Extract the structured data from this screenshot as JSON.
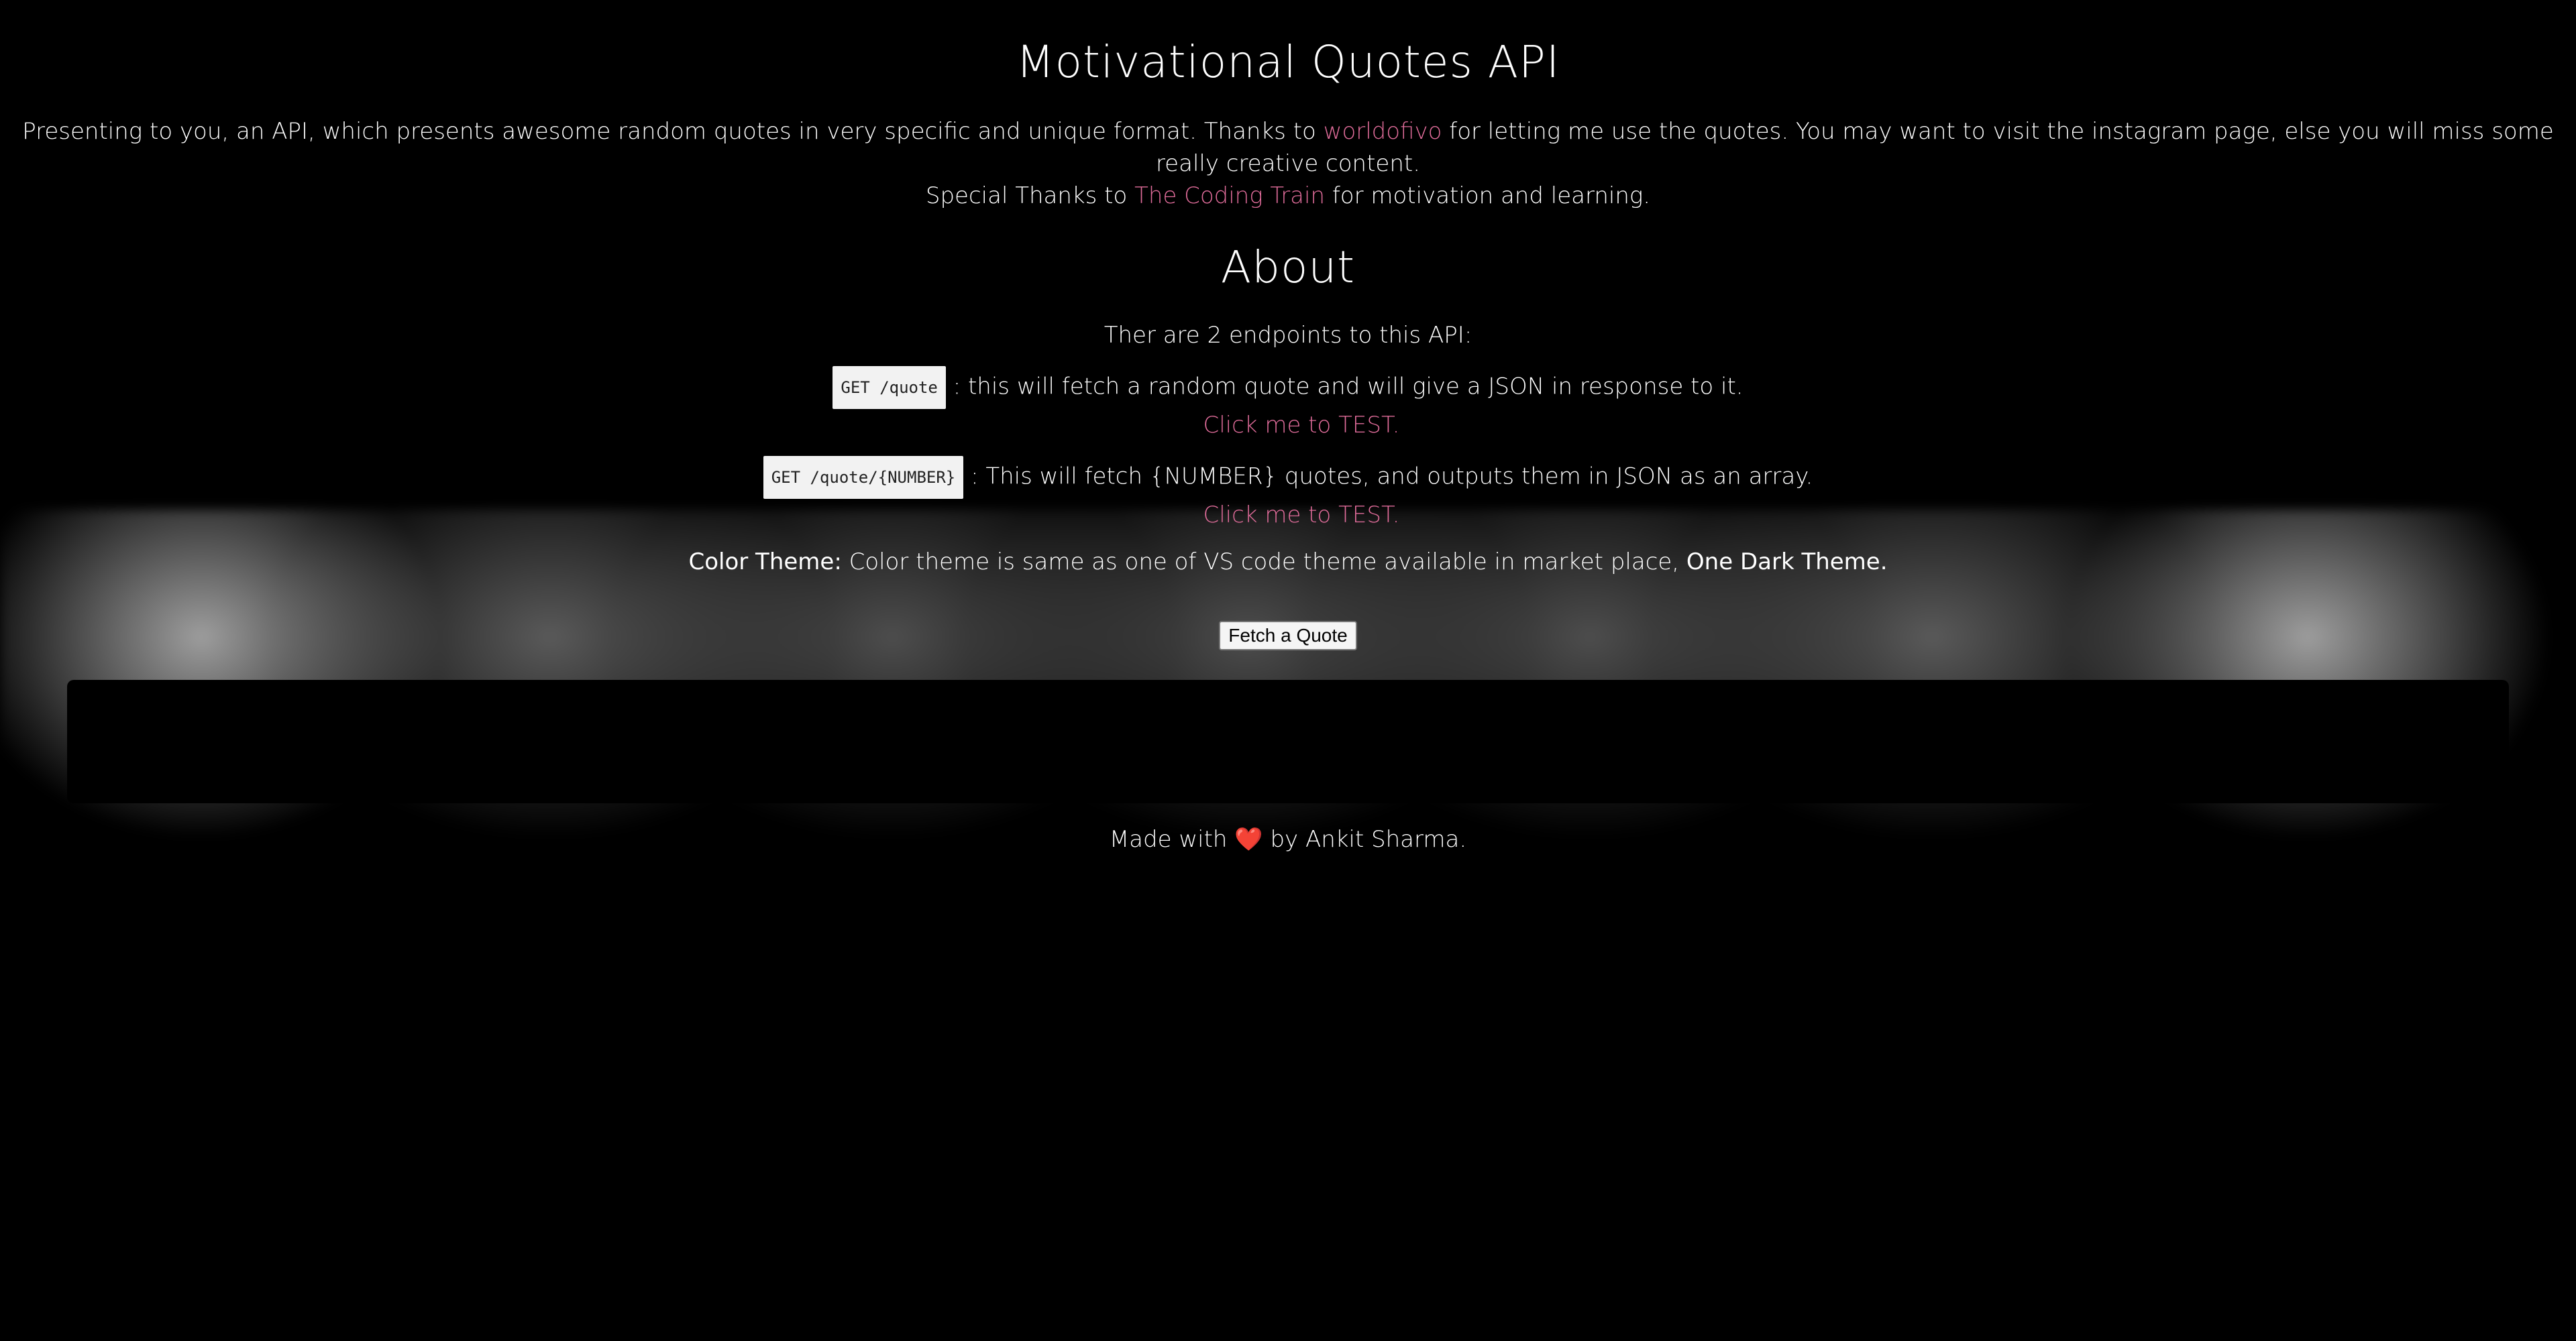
{
  "header": {
    "title": "Motivational Quotes API"
  },
  "intro": {
    "text_1": "Presenting to you, an API, which presents awesome random quotes in very specific and unique format. Thanks to",
    "link_1": "worldofivo",
    "text_2": "for letting me use the quotes. You may want to visit the instagram page, else you will miss some really creative content.",
    "text_3": "Special Thanks to",
    "link_2": "The Coding Train",
    "text_4": "for motivation and learning."
  },
  "about": {
    "title": "About",
    "endpoints_intro": "Ther are 2 endpoints to this API:",
    "endpoints": [
      {
        "code": "GET /quote",
        "description": ": this will fetch a random quote and will give a JSON in response to it.",
        "test_link": "Click me to TEST."
      },
      {
        "code": "GET /quote/{NUMBER}",
        "description": ": This will fetch {NUMBER} quotes, and outputs them in JSON as an array.",
        "test_link": "Click me to TEST."
      }
    ],
    "color_theme_label": "Color Theme:",
    "color_theme_text": "Color theme is same as one of VS code theme available in market place,",
    "color_theme_name": "One Dark Theme."
  },
  "actions": {
    "fetch_button": "Fetch a Quote"
  },
  "footer": {
    "text_1": "Made with",
    "heart": "❤️",
    "text_2": "by Ankit Sharma."
  },
  "colors": {
    "background": "#000000",
    "text": "#ffffff",
    "link": "#e06c9a"
  }
}
